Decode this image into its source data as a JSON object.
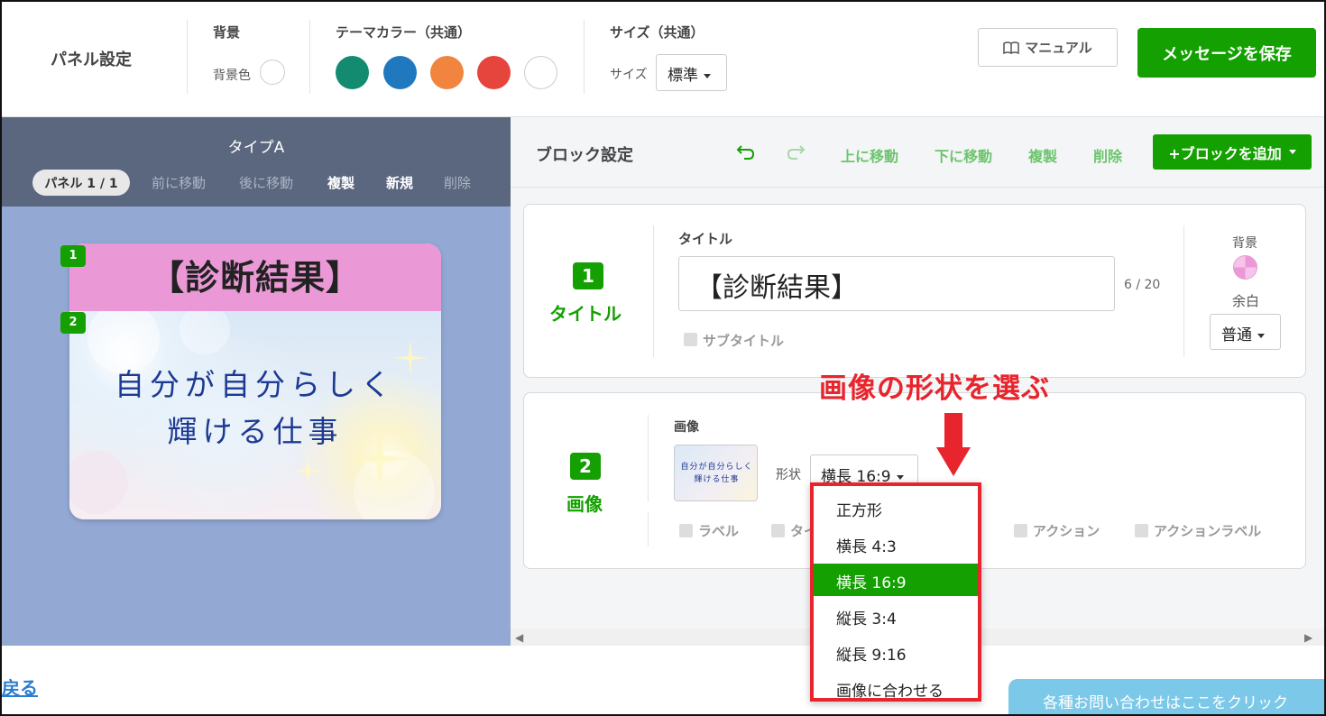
{
  "topbar": {
    "panel_settings": "パネル設定",
    "bg_heading": "背景",
    "bg_color_label": "背景色",
    "theme_heading": "テーマカラー（共通）",
    "theme_colors": [
      "#138b70",
      "#2078bf",
      "#f1843f",
      "#e5453d",
      "#ffffff"
    ],
    "size_heading": "サイズ（共通）",
    "size_label": "サイズ",
    "size_value": "標準",
    "manual_label": "マニュアル",
    "save_label": "メッセージを保存"
  },
  "left_panel": {
    "type_label": "タイプA",
    "panel_pill": "パネル 1 / 1",
    "actions": [
      "前に移動",
      "後に移動",
      "複製",
      "新規",
      "削除"
    ],
    "card": {
      "title": "【診断結果】",
      "image_text_line1": "自分が自分らしく",
      "image_text_line2": "輝ける仕事",
      "badge1": "1",
      "badge2": "2"
    }
  },
  "block_settings": {
    "title": "ブロック設定",
    "undo_icon": "undo-icon",
    "redo_icon": "redo-icon",
    "actions": [
      "上に移動",
      "下に移動",
      "複製",
      "削除"
    ],
    "add_block_label": "+ブロックを追加",
    "block1": {
      "number": "1",
      "label": "タイトル",
      "field_label": "タイトル",
      "value": "【診断結果】",
      "counter": "6 / 20",
      "subtitle_label": "サブタイトル",
      "bg_label": "背景",
      "margin_label": "余白",
      "margin_value": "普通"
    },
    "block2": {
      "number": "2",
      "label": "画像",
      "field_label": "画像",
      "shape_label": "形状",
      "shape_value": "横長 16:9",
      "checkboxes": [
        "ラベル",
        "タイ",
        "アクション",
        "アクションラベル"
      ],
      "thumb_line1": "自分が自分らしく",
      "thumb_line2": "輝ける仕事"
    }
  },
  "annotation": {
    "text": "画像の形状を選ぶ",
    "color": "#e8242c"
  },
  "dropdown": {
    "options": [
      "正方形",
      "横長 4:3",
      "横長 16:9",
      "縦長 3:4",
      "縦長 9:16",
      "画像に合わせる"
    ],
    "selected": "横長 16:9"
  },
  "footer": {
    "back_label": "戻る",
    "contact_label": "各種お問い合わせはここをクリック"
  },
  "colors": {
    "accent_green": "#13a000",
    "left_head_bg": "#5a677f",
    "left_body_bg": "#93a9d4",
    "title_bar_pink": "#eb98d7"
  }
}
